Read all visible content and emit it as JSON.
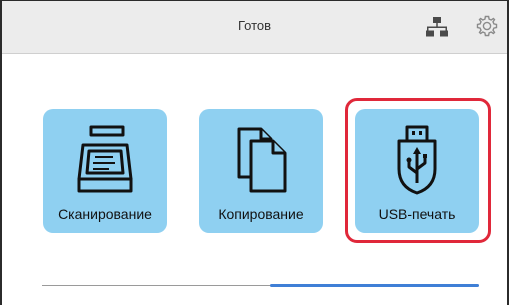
{
  "status_bar": {
    "status_text": "Готов",
    "network_icon": "network-icon",
    "settings_icon": "gear-icon"
  },
  "tiles": [
    {
      "label": "Сканирование",
      "icon": "scanner-icon"
    },
    {
      "label": "Копирование",
      "icon": "copy-documents-icon"
    },
    {
      "label": "USB-печать",
      "icon": "usb-icon",
      "selected": true
    }
  ],
  "pager": {
    "page_count": 2,
    "active_page": 2
  },
  "colors": {
    "tile_background": "#8fd0f1",
    "selection_outline": "#e0283a",
    "page_indicator": "#3f7fd6",
    "status_bar_background": "#ececec"
  }
}
